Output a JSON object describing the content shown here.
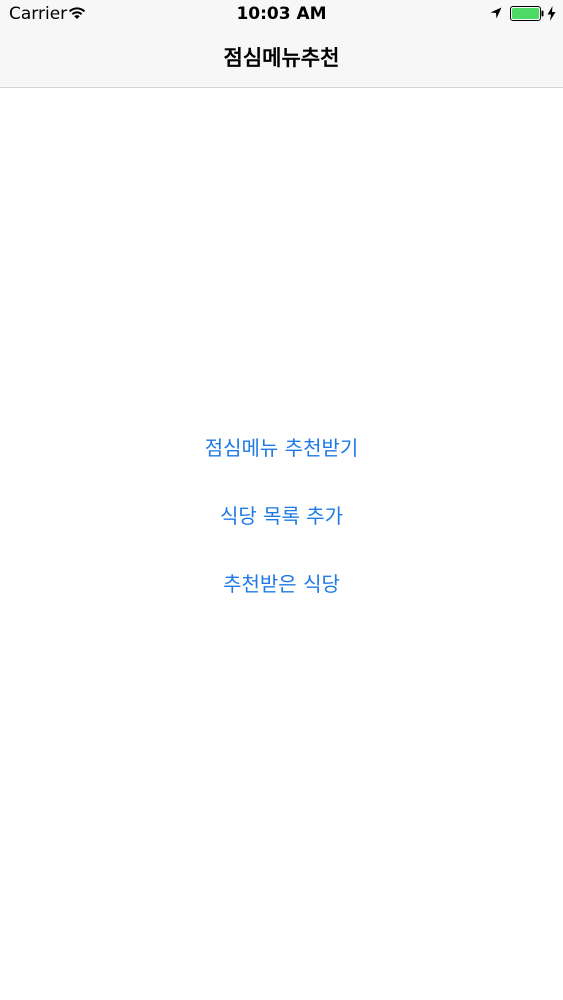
{
  "status_bar": {
    "carrier": "Carrier",
    "time": "10:03 AM",
    "icons": [
      "wifi-icon",
      "location-icon",
      "battery-icon",
      "charging-icon"
    ],
    "battery_color": "#4cd964"
  },
  "nav": {
    "title": "점심메뉴추천"
  },
  "menu": {
    "items": [
      {
        "label": "점심메뉴 추천받기"
      },
      {
        "label": "식당 목록 추가"
      },
      {
        "label": "추천받은 식당"
      }
    ]
  },
  "colors": {
    "accent": "#1f7ae6",
    "nav_background": "#f7f7f7",
    "divider": "#d4d4d8"
  }
}
